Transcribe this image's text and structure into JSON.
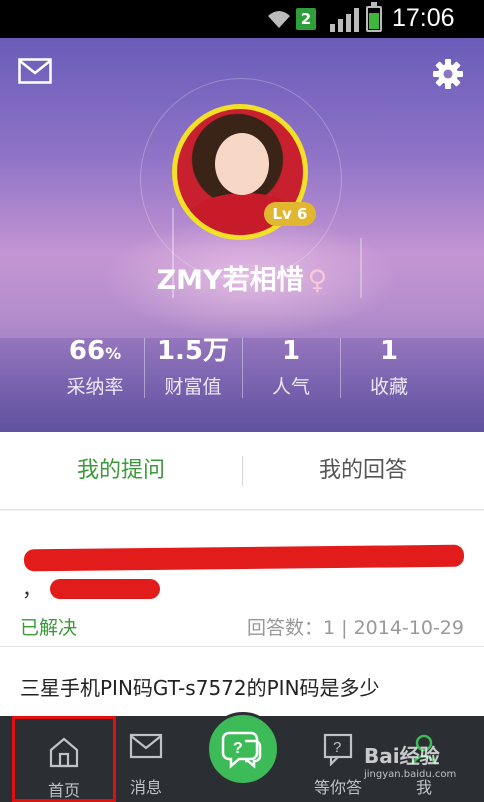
{
  "status_bar": {
    "sim_badge": "2",
    "time": "17:06"
  },
  "profile": {
    "username": "ZMY若相惜",
    "gender_symbol": "♀",
    "level": "Lv 6"
  },
  "stats": [
    {
      "value": "66",
      "unit": "%",
      "label": "采纳率"
    },
    {
      "value": "1.5万",
      "unit": "",
      "label": "财富值"
    },
    {
      "value": "1",
      "unit": "",
      "label": "人气"
    },
    {
      "value": "1",
      "unit": "",
      "label": "收藏"
    }
  ],
  "tabs": [
    {
      "label": "我的提问",
      "active": true
    },
    {
      "label": "我的回答",
      "active": false
    }
  ],
  "questions": [
    {
      "visible_prefix": "，",
      "status": "已解决",
      "meta": "回答数：1 | 2014-10-29"
    },
    {
      "title": "三星手机PIN码GT-s7572的PIN码是多少"
    }
  ],
  "bottom_nav": [
    {
      "label": "首页",
      "icon": "home-icon"
    },
    {
      "label": "消息",
      "icon": "mail-icon"
    },
    {
      "label": "",
      "icon": "ask-icon"
    },
    {
      "label": "等你答",
      "icon": "question-box-icon"
    },
    {
      "label": "我",
      "icon": "person-icon"
    }
  ],
  "watermark": {
    "brand": "Bai经验",
    "url": "jingyan.baidu.com"
  },
  "colors": {
    "accent_green": "#3b9a3b",
    "nav_bg": "#2b2e33",
    "highlight_red": "#e01010"
  }
}
